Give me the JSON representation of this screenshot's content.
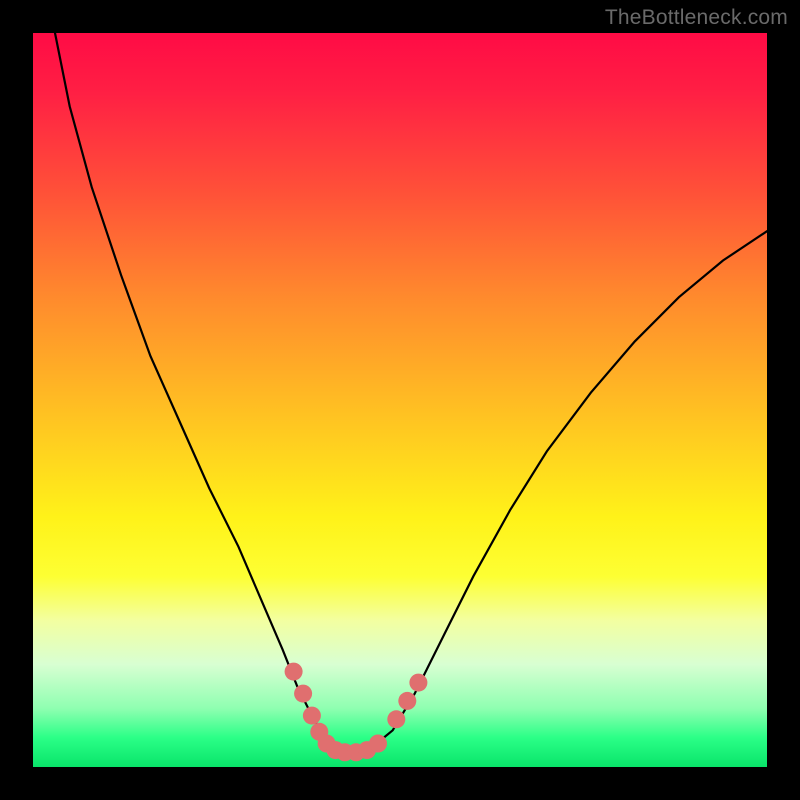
{
  "watermark": "TheBottleneck.com",
  "chart_data": {
    "type": "line",
    "title": "",
    "xlabel": "",
    "ylabel": "",
    "xlim": [
      0,
      100
    ],
    "ylim": [
      0,
      100
    ],
    "series": [
      {
        "name": "bottleneck-curve",
        "x": [
          3,
          5,
          8,
          12,
          16,
          20,
          24,
          28,
          31,
          34,
          36,
          38,
          40,
          42,
          44,
          46,
          49,
          52,
          56,
          60,
          65,
          70,
          76,
          82,
          88,
          94,
          100
        ],
        "values": [
          100,
          90,
          79,
          67,
          56,
          47,
          38,
          30,
          23,
          16,
          11,
          7,
          3.5,
          2,
          2,
          2.5,
          5,
          10,
          18,
          26,
          35,
          43,
          51,
          58,
          64,
          69,
          73
        ]
      }
    ],
    "annotations": [
      {
        "name": "marker-left-upper",
        "x": 35.5,
        "y": 13.0
      },
      {
        "name": "marker-left-1",
        "x": 36.8,
        "y": 10.0
      },
      {
        "name": "marker-left-2",
        "x": 38.0,
        "y": 7.0
      },
      {
        "name": "marker-left-3",
        "x": 39.0,
        "y": 4.8
      },
      {
        "name": "marker-left-4",
        "x": 40.0,
        "y": 3.2
      },
      {
        "name": "marker-bottom-1",
        "x": 41.2,
        "y": 2.3
      },
      {
        "name": "marker-bottom-2",
        "x": 42.5,
        "y": 2.0
      },
      {
        "name": "marker-bottom-3",
        "x": 44.0,
        "y": 2.0
      },
      {
        "name": "marker-bottom-4",
        "x": 45.5,
        "y": 2.3
      },
      {
        "name": "marker-right-1",
        "x": 47.0,
        "y": 3.2
      },
      {
        "name": "marker-right-2",
        "x": 49.5,
        "y": 6.5
      },
      {
        "name": "marker-right-3",
        "x": 51.0,
        "y": 9.0
      },
      {
        "name": "marker-right-upper",
        "x": 52.5,
        "y": 11.5
      }
    ],
    "marker_color": "#e06f6f",
    "curve_color": "#000000",
    "background_gradient": [
      "#ff0b45",
      "#ff5238",
      "#ffc222",
      "#fdff33",
      "#2bff87",
      "#09e46a"
    ]
  }
}
